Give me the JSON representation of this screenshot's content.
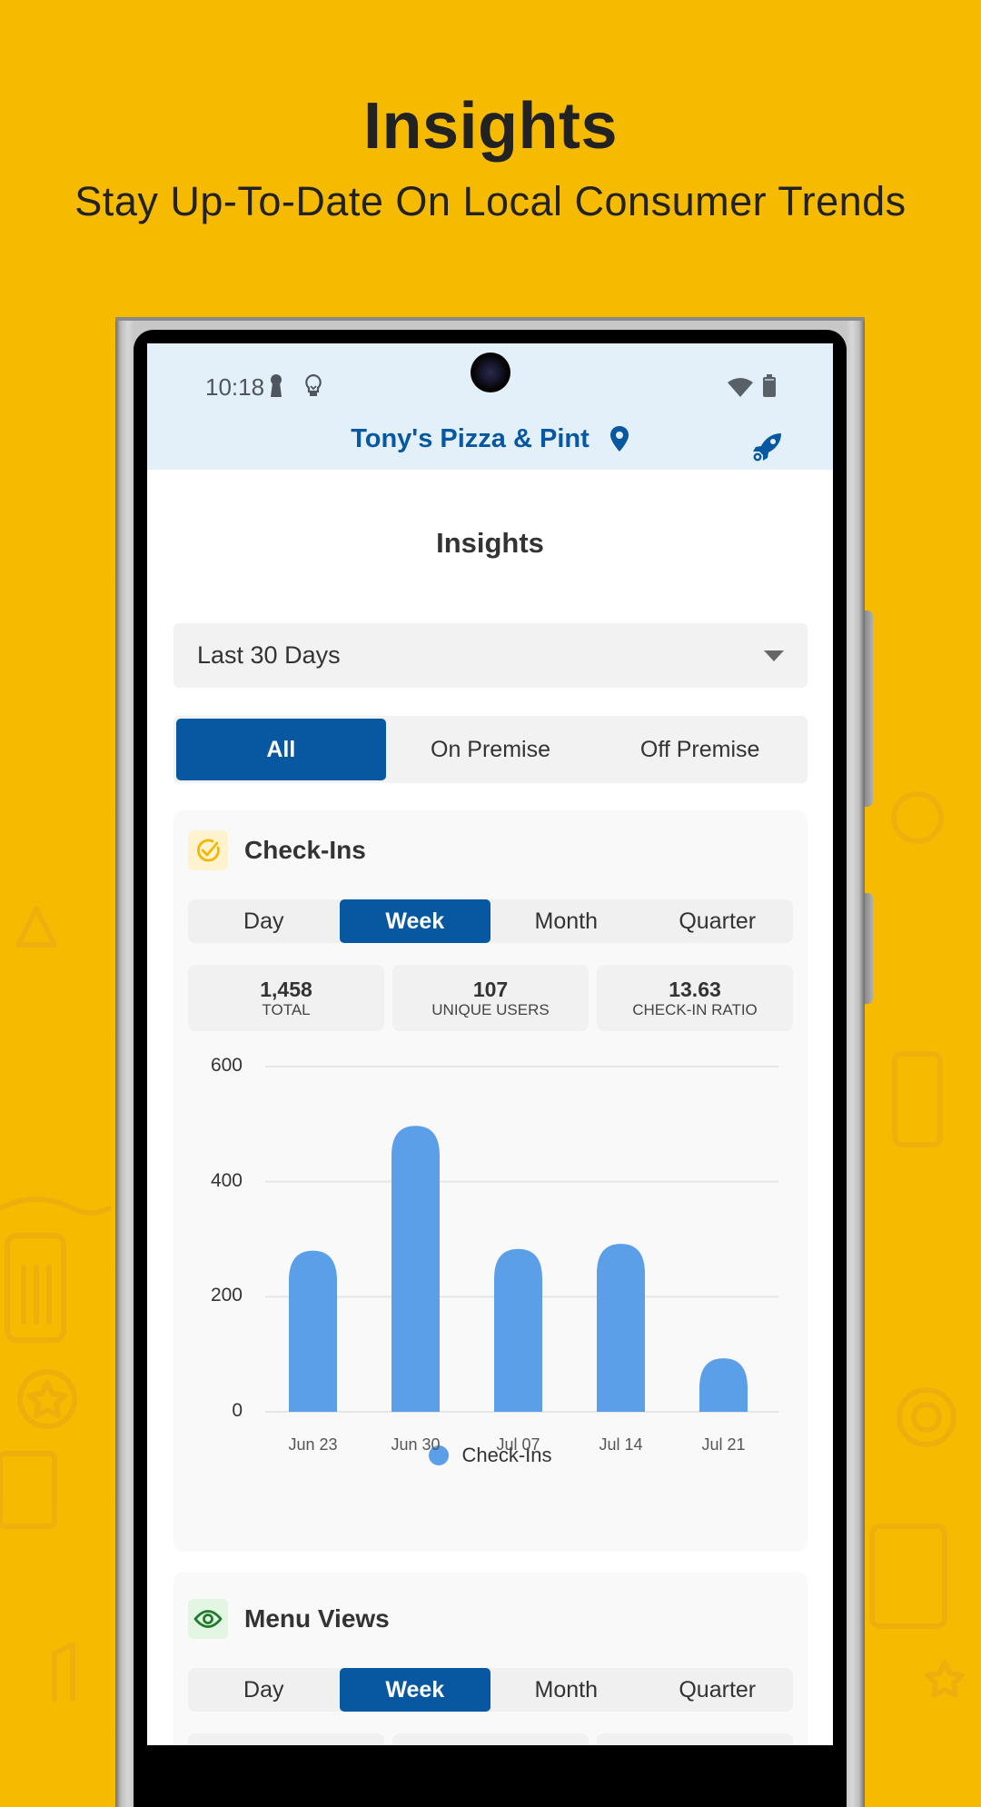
{
  "hero": {
    "title": "Insights",
    "subtitle": "Stay Up-To-Date On Local Consumer Trends"
  },
  "colors": {
    "background": "#F6BB00",
    "brand_blue": "#0758A0",
    "bar_blue": "#5A9FE8",
    "header_bg": "#E3F0FA"
  },
  "status_bar": {
    "time": "10:18",
    "left_icons": [
      "keyhole-icon",
      "lightbulb-icon"
    ],
    "right_icons": [
      "wifi-icon",
      "battery-icon"
    ]
  },
  "app_header": {
    "business_name": "Tony's Pizza & Pint",
    "location_icon": "map-pin-icon",
    "action_icon": "rocket-icon"
  },
  "page": {
    "title": "Insights",
    "date_range": {
      "selected": "Last 30 Days"
    },
    "premise_filter": {
      "options": [
        "All",
        "On Premise",
        "Off Premise"
      ],
      "active": "All"
    }
  },
  "checkins": {
    "title": "Check-Ins",
    "icon": "check-circle-icon",
    "tabs": [
      "Day",
      "Week",
      "Month",
      "Quarter"
    ],
    "active_tab": "Week",
    "stats": [
      {
        "value": "1,458",
        "label": "TOTAL"
      },
      {
        "value": "107",
        "label": "UNIQUE USERS"
      },
      {
        "value": "13.63",
        "label": "CHECK-IN RATIO"
      }
    ]
  },
  "menu_views": {
    "title": "Menu Views",
    "icon": "eye-icon",
    "tabs": [
      "Day",
      "Week",
      "Month",
      "Quarter"
    ],
    "active_tab": "Week"
  },
  "chart_data": {
    "type": "bar",
    "title": "",
    "xlabel": "",
    "ylabel": "",
    "categories": [
      "Jun 23",
      "Jun 30",
      "Jul 07",
      "Jul 14",
      "Jul 21"
    ],
    "series": [
      {
        "name": "Check-Ins",
        "values": [
          280,
          497,
          283,
          292,
          93
        ]
      }
    ],
    "ylim": [
      0,
      600
    ],
    "yticks": [
      0,
      200,
      400,
      600
    ],
    "grid": true,
    "legend": "bottom-center"
  }
}
